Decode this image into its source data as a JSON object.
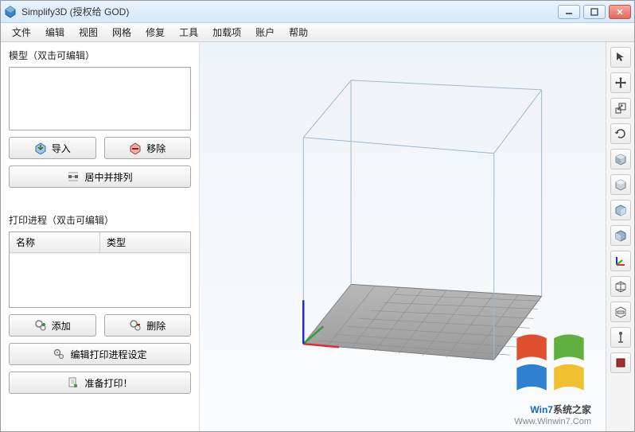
{
  "window": {
    "title": "Simplify3D (授权给 GOD)"
  },
  "menubar": {
    "items": [
      "文件",
      "编辑",
      "视图",
      "网格",
      "修复",
      "工具",
      "加载项",
      "账户",
      "帮助"
    ]
  },
  "models_panel": {
    "title": "模型（双击可编辑）",
    "import_label": "导入",
    "remove_label": "移除",
    "center_arrange_label": "居中并排列"
  },
  "processes_panel": {
    "title": "打印进程（双击可编辑）",
    "col_name": "名称",
    "col_type": "类型",
    "add_label": "添加",
    "delete_label": "删除",
    "edit_settings_label": "编辑打印进程设定",
    "prepare_label": "准备打印！"
  },
  "watermark": {
    "brand_prefix": "Win7",
    "brand_suffix": "系统之家",
    "url": "Www.Winwin7.Com"
  },
  "right_tools": {
    "items": [
      "select-tool",
      "move-tool",
      "scale-tool",
      "rotate-tool",
      "view-cube-iso",
      "view-cube-top",
      "view-cube-front",
      "view-cube-right",
      "axes-tool",
      "wireframe-view",
      "cross-section",
      "support-tool",
      "paint-tool"
    ]
  }
}
